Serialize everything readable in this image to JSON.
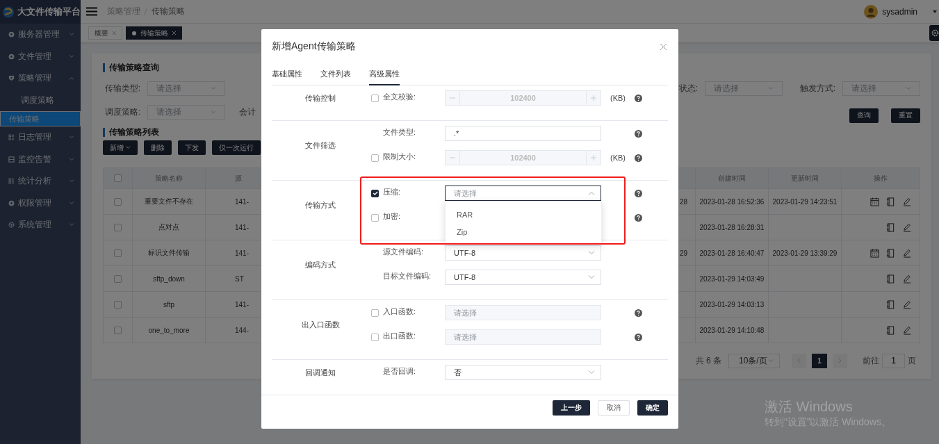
{
  "sidebar": {
    "logo": "大文件传输平台",
    "items": [
      {
        "label": "服务器管理",
        "expanded": false
      },
      {
        "label": "文件管理",
        "expanded": false
      },
      {
        "label": "策略管理",
        "expanded": true,
        "children": [
          {
            "label": "调度策略",
            "selected": false
          },
          {
            "label": "传输策略",
            "selected": true
          }
        ]
      },
      {
        "label": "日志管理",
        "expanded": false
      },
      {
        "label": "监控告警",
        "expanded": false
      },
      {
        "label": "统计分析",
        "expanded": false
      },
      {
        "label": "权限管理",
        "expanded": false
      },
      {
        "label": "系统管理",
        "expanded": false
      }
    ]
  },
  "header": {
    "breadcrumb": [
      "策略管理",
      "传输策略"
    ],
    "user": "sysadmin"
  },
  "tags": [
    {
      "label": "概要",
      "selected": false
    },
    {
      "label": "传输策略",
      "selected": true
    }
  ],
  "query": {
    "title": "传输策略查询",
    "filters": [
      {
        "label": "传输类型:",
        "placeholder": "请选择"
      },
      {
        "label": "状态:",
        "placeholder": "请选择"
      },
      {
        "label": "触发方式:",
        "placeholder": "请选择"
      },
      {
        "label": "调度策略:",
        "placeholder": "请选择"
      }
    ],
    "cut_label": "会计",
    "buttons": [
      "查询",
      "重置"
    ]
  },
  "list": {
    "title": "传输策略列表",
    "buttons": [
      {
        "label": "新增",
        "dropdown": true
      },
      {
        "label": "删除",
        "dropdown": false
      },
      {
        "label": "下发",
        "dropdown": false
      },
      {
        "label": "仅一次运行",
        "dropdown": false
      }
    ],
    "all_checked": false,
    "columns": {
      "name": "策略名称",
      "column_3": "源",
      "created": "创建时间",
      "updated": "更新时间",
      "actions": "操作"
    },
    "rows": [
      {
        "checked": false,
        "name": "重要文件不存在",
        "column_3": "141-",
        "column_4": "28",
        "created": "2023-01-28 16:52:36",
        "updated": "2023-01-29 14:23:51",
        "actions": [
          {
            "kind": "calendar"
          },
          {
            "kind": "notebook"
          },
          {
            "kind": "edit"
          }
        ]
      },
      {
        "checked": false,
        "name": "点对点",
        "column_3": "141-",
        "created": "2023-01-28 16:28:31",
        "actions": [
          {
            "kind": "notebook"
          },
          {
            "kind": "edit"
          }
        ]
      },
      {
        "checked": false,
        "name": "标识文件传输",
        "column_3": "141-",
        "column_4": "29",
        "created": "2023-01-28 16:40:47",
        "updated": "2023-01-29 13:39:29",
        "actions": [
          {
            "kind": "calendar"
          },
          {
            "kind": "notebook"
          },
          {
            "kind": "edit"
          }
        ]
      },
      {
        "checked": false,
        "name": "sftp_down",
        "column_3": "ST",
        "created": "2023-01-29 14:03:49",
        "actions": [
          {
            "kind": "notebook"
          },
          {
            "kind": "edit"
          }
        ]
      },
      {
        "checked": false,
        "name": "sftp",
        "column_3": "141-",
        "created": "2023-01-29 14:03:13",
        "actions": [
          {
            "kind": "notebook"
          },
          {
            "kind": "edit"
          }
        ]
      },
      {
        "checked": false,
        "name": "one_to_more",
        "column_3": "144-",
        "created": "2023-01-29 14:10:48",
        "actions": [
          {
            "kind": "notebook"
          },
          {
            "kind": "edit"
          }
        ]
      }
    ]
  },
  "pagination": {
    "total": "共 6 条",
    "page_size": "10条/页",
    "pages": [
      {
        "label": "1",
        "selected": true
      }
    ],
    "goto_label": "前往",
    "goto_value": "1",
    "goto_suffix": "页"
  },
  "modal": {
    "title": "新增Agent传输策略",
    "tabs": [
      {
        "label": "基础属性",
        "selected": false
      },
      {
        "label": "文件列表",
        "selected": false
      },
      {
        "label": "高级属性",
        "selected": true
      }
    ],
    "sections": [
      {
        "label": "传输控制",
        "rows": [
          {
            "kind": "number",
            "checked": false,
            "label": "全文校验:",
            "value": "102400",
            "disabled": true,
            "unit": "(KB)",
            "help": true
          }
        ]
      },
      {
        "label": "文件筛选",
        "rows": [
          {
            "kind": "text",
            "label": "文件类型:",
            "value": ".*",
            "help": true
          },
          {
            "kind": "number",
            "checked": false,
            "label": "限制大小:",
            "value": "102400",
            "disabled": true,
            "unit": "(KB)",
            "help": true
          }
        ]
      },
      {
        "label": "传输方式",
        "rows": [
          {
            "kind": "select",
            "checked": true,
            "label": "压缩:",
            "placeholder": "请选择",
            "disabled": false,
            "open": true,
            "options": [
              "RAR",
              "Zip"
            ],
            "help": true
          },
          {
            "kind": "covered",
            "checked": false,
            "label": "加密:",
            "help": true
          }
        ]
      },
      {
        "label": "编码方式",
        "rows": [
          {
            "kind": "select",
            "label": "源文件编码:",
            "value": "UTF-8",
            "disabled": false,
            "open": false,
            "help": false
          },
          {
            "kind": "select",
            "label": "目标文件编码:",
            "value": "UTF-8",
            "disabled": false,
            "open": false,
            "help": false
          }
        ]
      },
      {
        "label": "出入口函数",
        "rows": [
          {
            "kind": "select",
            "checked": false,
            "label": "入口函数:",
            "placeholder": "请选择",
            "disabled": true,
            "help": true
          },
          {
            "kind": "select",
            "checked": false,
            "label": "出口函数:",
            "placeholder": "请选择",
            "disabled": true,
            "help": true
          }
        ]
      },
      {
        "label": "回调通知",
        "rows": [
          {
            "kind": "select",
            "label": "是否回调:",
            "value": "否",
            "disabled": false,
            "open": false,
            "help": false
          }
        ]
      }
    ],
    "buttons": [
      {
        "label": "上一步",
        "kind": "primary"
      },
      {
        "label": "取消",
        "kind": "plain"
      },
      {
        "label": "确定",
        "kind": "primary"
      }
    ]
  },
  "os_notice": {
    "title": "激活 Windows",
    "hint": "转到“设置”以激活 Windows。"
  }
}
